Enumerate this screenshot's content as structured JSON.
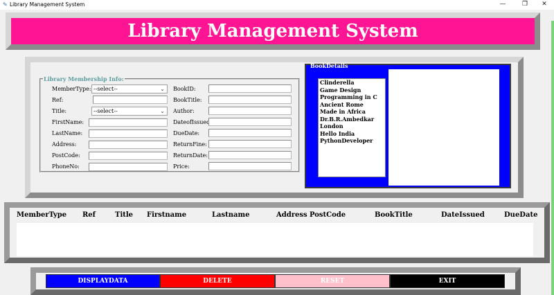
{
  "window": {
    "title": "Library Management System",
    "minimize": "—",
    "maximize": "❐",
    "close": "✕"
  },
  "header": {
    "title": "Library Management System"
  },
  "membership": {
    "group_title": "Library Membership Info:",
    "member_type": {
      "label": "MemberType:",
      "value": "--select--"
    },
    "ref": {
      "label": "Ref:"
    },
    "title": {
      "label": "Title:",
      "value": "--select--"
    },
    "firstname": {
      "label": "FirstName:"
    },
    "lastname": {
      "label": "LastName:"
    },
    "address": {
      "label": "Address:"
    },
    "postcode": {
      "label": "PostCode:"
    },
    "phoneno": {
      "label": "PhoneNo:"
    },
    "bookid": {
      "label": "BookID:"
    },
    "booktitle": {
      "label": "BookTitle:"
    },
    "author": {
      "label": "Author:"
    },
    "dateissued": {
      "label": "DateofIssued:"
    },
    "duedate": {
      "label": "DueDate:"
    },
    "returnfine": {
      "label": "ReturnFine:"
    },
    "returndate": {
      "label": "ReturnDate:"
    },
    "price": {
      "label": "Price:"
    }
  },
  "book_details": {
    "group_title": "BookDetails",
    "books": [
      "Clinderella",
      "Game Design",
      "Programming in C",
      "Ancient Rome",
      "Made in Africa",
      "Dr.B.R.Ambedkar",
      "London",
      "Hello India",
      "PythonDeveloper"
    ]
  },
  "table": {
    "columns": [
      "MemberType",
      "Ref",
      "Title",
      "Firstname",
      "Lastname",
      "Address",
      "PostCode",
      "BookTitle",
      "DateIssued",
      "DueDate"
    ]
  },
  "buttons": {
    "display": "DISPLAYDATA",
    "delete": "DELETE",
    "reset": "RESET",
    "exit": "EXIT"
  },
  "colors": {
    "banner": "#ff1493",
    "book_panel": "#0000ff",
    "display_btn": "#0000ff",
    "delete_btn": "#ff0000",
    "reset_btn": "#ffc0cb",
    "exit_btn": "#000000"
  }
}
